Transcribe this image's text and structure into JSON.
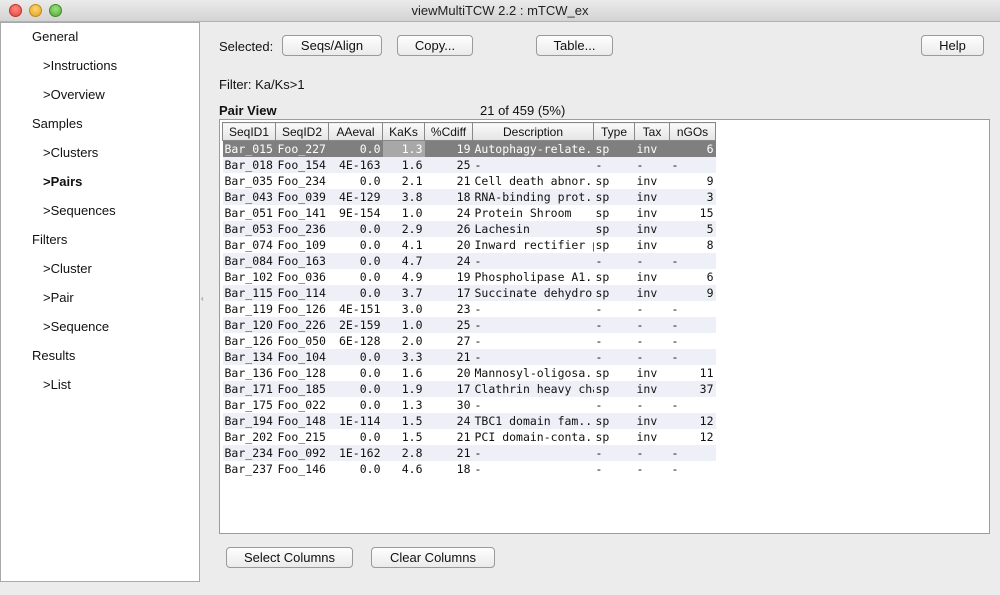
{
  "window": {
    "title": "viewMultiTCW 2.2 : mTCW_ex"
  },
  "sidebar": {
    "items": [
      {
        "label": "General",
        "indent": false,
        "bold": false
      },
      {
        "label": ">Instructions",
        "indent": true,
        "bold": false
      },
      {
        "label": ">Overview",
        "indent": true,
        "bold": false
      },
      {
        "label": "Samples",
        "indent": false,
        "bold": false
      },
      {
        "label": ">Clusters",
        "indent": true,
        "bold": false
      },
      {
        "label": ">Pairs",
        "indent": true,
        "bold": true
      },
      {
        "label": ">Sequences",
        "indent": true,
        "bold": false
      },
      {
        "label": "Filters",
        "indent": false,
        "bold": false
      },
      {
        "label": ">Cluster",
        "indent": true,
        "bold": false
      },
      {
        "label": ">Pair",
        "indent": true,
        "bold": false
      },
      {
        "label": ">Sequence",
        "indent": true,
        "bold": false
      },
      {
        "label": "Results",
        "indent": false,
        "bold": false
      },
      {
        "label": ">List",
        "indent": true,
        "bold": false
      }
    ]
  },
  "toolbar": {
    "selected_label": "Selected:",
    "seqs_align": "Seqs/Align",
    "copy": "Copy...",
    "table": "Table...",
    "help": "Help"
  },
  "filter_text": "Filter: Ka/Ks>1",
  "pair_view": {
    "title": "Pair View",
    "count": "21 of 459 (5%)"
  },
  "table": {
    "columns": [
      "SeqID1",
      "SeqID2",
      "AAeval",
      "KaKs",
      "%Cdiff",
      "Description",
      "Type",
      "Tax",
      "nGOs"
    ],
    "rows": [
      [
        "Bar_015",
        "Foo_227",
        "0.0",
        "1.3",
        "19",
        "Autophagy-relate...",
        "sp",
        "inv",
        "6"
      ],
      [
        "Bar_018",
        "Foo_154",
        "4E-163",
        "1.6",
        "25",
        "-",
        "-",
        "-",
        "-"
      ],
      [
        "Bar_035",
        "Foo_234",
        "0.0",
        "2.1",
        "21",
        "Cell death abnor...",
        "sp",
        "inv",
        "9"
      ],
      [
        "Bar_043",
        "Foo_039",
        "4E-129",
        "3.8",
        "18",
        "RNA-binding prot...",
        "sp",
        "inv",
        "3"
      ],
      [
        "Bar_051",
        "Foo_141",
        "9E-154",
        "1.0",
        "24",
        "Protein Shroom",
        "sp",
        "inv",
        "15"
      ],
      [
        "Bar_053",
        "Foo_236",
        "0.0",
        "2.9",
        "26",
        "Lachesin",
        "sp",
        "inv",
        "5"
      ],
      [
        "Bar_074",
        "Foo_109",
        "0.0",
        "4.1",
        "20",
        "Inward rectifier p...",
        "sp",
        "inv",
        "8"
      ],
      [
        "Bar_084",
        "Foo_163",
        "0.0",
        "4.7",
        "24",
        "-",
        "-",
        "-",
        "-"
      ],
      [
        "Bar_102",
        "Foo_036",
        "0.0",
        "4.9",
        "19",
        "Phospholipase A1...",
        "sp",
        "inv",
        "6"
      ],
      [
        "Bar_115",
        "Foo_114",
        "0.0",
        "3.7",
        "17",
        "Succinate dehydro...",
        "sp",
        "inv",
        "9"
      ],
      [
        "Bar_119",
        "Foo_126",
        "4E-151",
        "3.0",
        "23",
        "-",
        "-",
        "-",
        "-"
      ],
      [
        "Bar_120",
        "Foo_226",
        "2E-159",
        "1.0",
        "25",
        "-",
        "-",
        "-",
        "-"
      ],
      [
        "Bar_126",
        "Foo_050",
        "6E-128",
        "2.0",
        "27",
        "-",
        "-",
        "-",
        "-"
      ],
      [
        "Bar_134",
        "Foo_104",
        "0.0",
        "3.3",
        "21",
        "-",
        "-",
        "-",
        "-"
      ],
      [
        "Bar_136",
        "Foo_128",
        "0.0",
        "1.6",
        "20",
        "Mannosyl-oligosa...",
        "sp",
        "inv",
        "11"
      ],
      [
        "Bar_171",
        "Foo_185",
        "0.0",
        "1.9",
        "17",
        "Clathrin heavy cha...",
        "sp",
        "inv",
        "37"
      ],
      [
        "Bar_175",
        "Foo_022",
        "0.0",
        "1.3",
        "30",
        "-",
        "-",
        "-",
        "-"
      ],
      [
        "Bar_194",
        "Foo_148",
        "1E-114",
        "1.5",
        "24",
        "TBC1 domain fam...",
        "sp",
        "inv",
        "12"
      ],
      [
        "Bar_202",
        "Foo_215",
        "0.0",
        "1.5",
        "21",
        "PCI domain-conta...",
        "sp",
        "inv",
        "12"
      ],
      [
        "Bar_234",
        "Foo_092",
        "1E-162",
        "2.8",
        "21",
        "-",
        "-",
        "-",
        "-"
      ],
      [
        "Bar_237",
        "Foo_146",
        "0.0",
        "4.6",
        "18",
        "-",
        "-",
        "-",
        "-"
      ]
    ]
  },
  "bottom": {
    "select_columns": "Select Columns",
    "clear_columns": "Clear Columns"
  }
}
